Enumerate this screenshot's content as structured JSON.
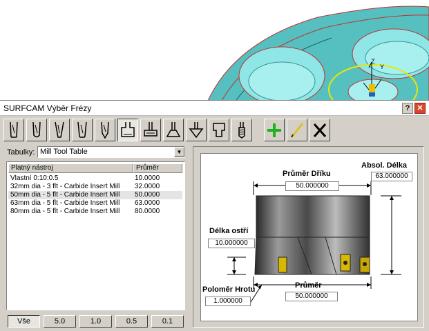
{
  "window": {
    "title": "SURFCAM Výběr Frézy"
  },
  "titlebar_buttons": {
    "help": "?",
    "close": "✕"
  },
  "toolbar": {
    "tools": [
      "flat-end-mill-icon",
      "ball-end-mill-icon",
      "tapered-mill-icon",
      "bull-nose-mill-icon",
      "chamfer-mill-icon",
      "face-mill-icon",
      "slot-mill-icon",
      "dovetail-mill-icon",
      "drill-icon",
      "counterbore-icon",
      "tap-icon",
      "add-icon",
      "edit-icon",
      "delete-icon"
    ],
    "active_tool": "face-mill-icon"
  },
  "tables": {
    "label": "Tabulky:",
    "selected": "Mill Tool Table"
  },
  "tool_list": {
    "columns": [
      "Platný nástroj",
      "Průměr"
    ],
    "rows": [
      {
        "name": "Vlastní 0:10:0.5",
        "diameter": "10.0000"
      },
      {
        "name": "32mm dia - 3 flt - Carbide Insert Mill",
        "diameter": "32.0000"
      },
      {
        "name": "50mm dia - 5 flt - Carbide Insert Mill",
        "diameter": "50.0000"
      },
      {
        "name": "63mm dia - 5 flt - Carbide Insert Mill",
        "diameter": "63.0000"
      },
      {
        "name": "80mm dia - 5 flt - Carbide Insert Mill",
        "diameter": "80.0000"
      }
    ],
    "selected_index": 2
  },
  "filters": {
    "items": [
      "Vše",
      "5.0",
      "1.0",
      "0.5",
      "0.1"
    ],
    "active": "Vše"
  },
  "dimensions": {
    "shank_diameter": {
      "label": "Průměr Dříku",
      "value": "50.000000"
    },
    "overall_length": {
      "label": "Absol. Délka",
      "value": "63.000000"
    },
    "flute_length": {
      "label": "Délka ostří",
      "value": "10.000000"
    },
    "corner_radius": {
      "label": "Poloměr Hrotu",
      "value": "1.000000"
    },
    "diameter": {
      "label": "Průměr",
      "value": "50.000000"
    }
  },
  "colors": {
    "part_surface": "#5cc6c6",
    "highlight_edge": "#e8e800",
    "edge_line": "#c03030",
    "add_icon": "#20b020",
    "delete_icon": "#000000",
    "close_button": "#d8472b"
  }
}
